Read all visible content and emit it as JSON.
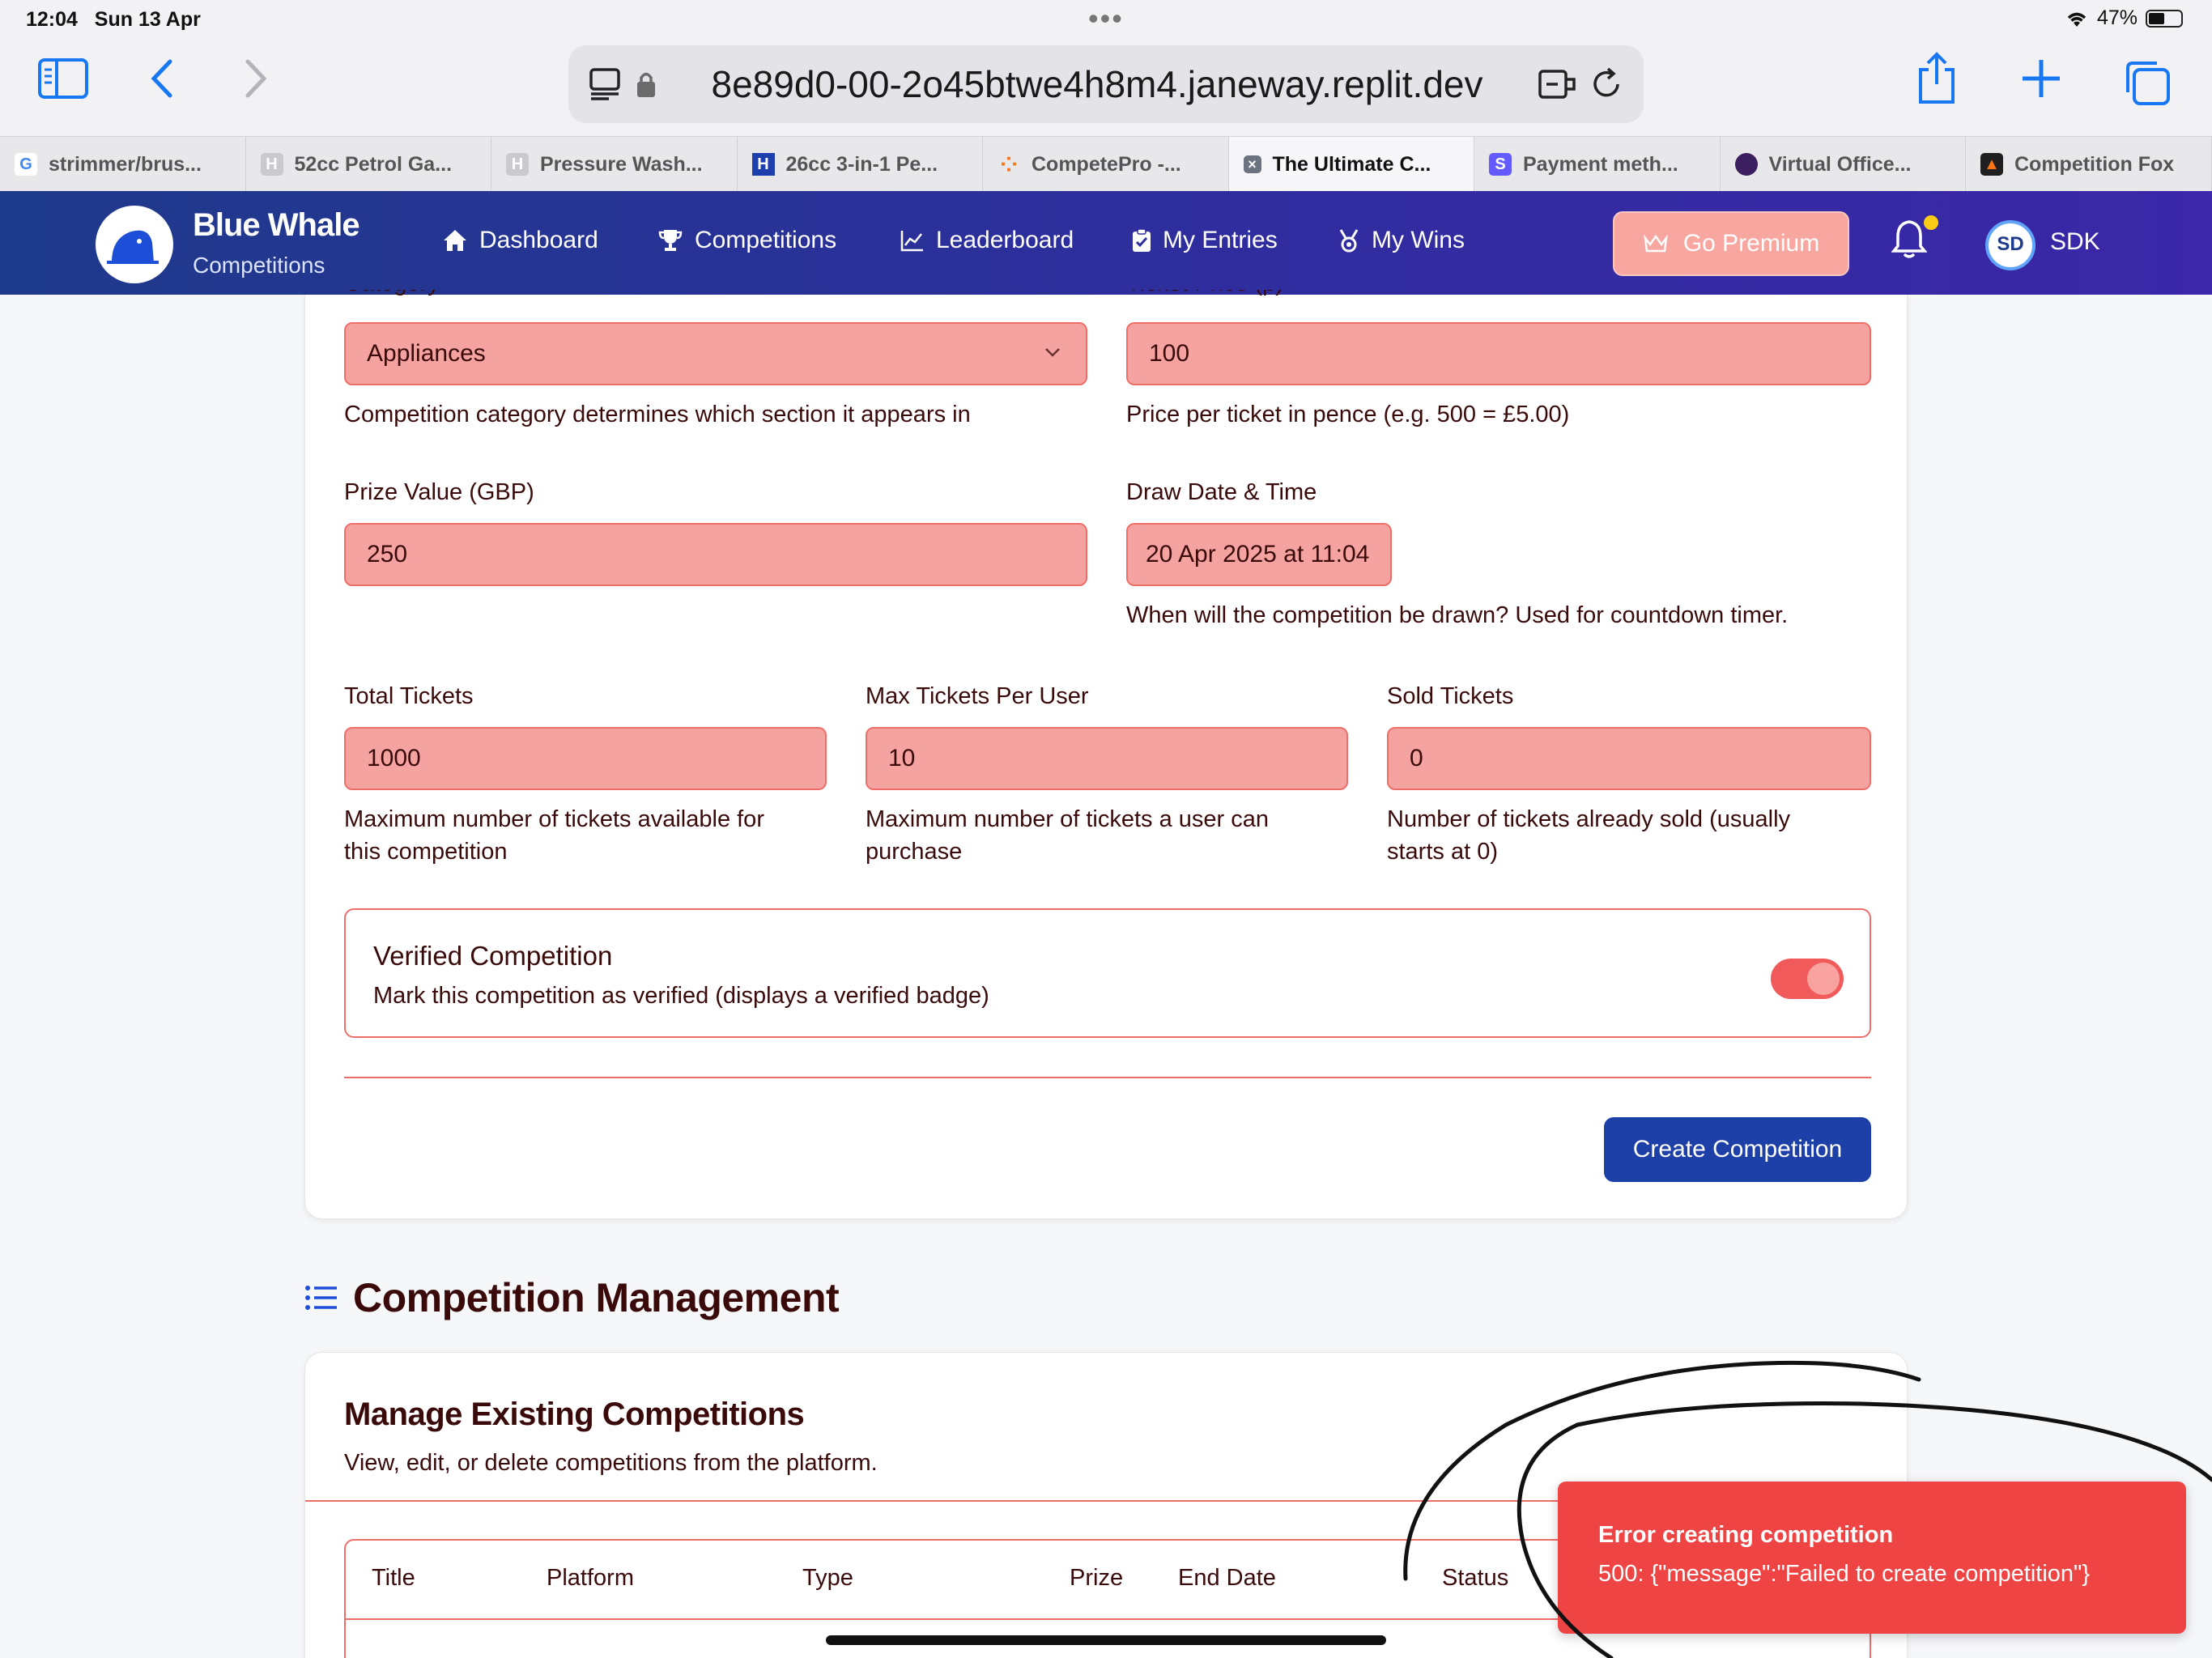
{
  "status": {
    "time": "12:04",
    "date": "Sun 13 Apr",
    "battery": "47%"
  },
  "browser": {
    "url": "8e89d0-00-2o45btwe4h8m4.janeway.replit.dev",
    "tabs": [
      {
        "label": "strimmer/brus...",
        "fav": "G",
        "fav_color": "#ffffff"
      },
      {
        "label": "52cc Petrol Ga...",
        "fav": "H",
        "fav_color": "#c9c9cf"
      },
      {
        "label": "Pressure Wash...",
        "fav": "H",
        "fav_color": "#c9c9cf"
      },
      {
        "label": "26cc 3-in-1 Pe...",
        "fav": "H",
        "fav_color": "#1e40af"
      },
      {
        "label": "CompetePro -...",
        "fav": "",
        "fav_color": "#f97316"
      },
      {
        "label": "The Ultimate C...",
        "fav": "×",
        "fav_color": "#6b7280"
      },
      {
        "label": "Payment meth...",
        "fav": "S",
        "fav_color": "#635bff"
      },
      {
        "label": "Virtual Office...",
        "fav": "",
        "fav_color": "#3b1f5e"
      },
      {
        "label": "Competition Fox",
        "fav": "",
        "fav_color": "#1f1f1f"
      }
    ]
  },
  "app": {
    "brand_title": "Blue Whale",
    "brand_sub": "Competitions",
    "nav": [
      "Dashboard",
      "Competitions",
      "Leaderboard",
      "My Entries",
      "My Wins"
    ],
    "premium": "Go Premium",
    "avatar": "SD",
    "username": "SDK"
  },
  "form": {
    "category_label": "Category",
    "category_value": "Appliances",
    "category_help": "Competition category determines which section it appears in",
    "price_label": "Ticket Price (p)",
    "price_value": "100",
    "price_help": "Price per ticket in pence (e.g. 500 = £5.00)",
    "prize_label": "Prize Value (GBP)",
    "prize_value": "250",
    "draw_label": "Draw Date & Time",
    "draw_value": "20 Apr 2025 at 11:04",
    "draw_help": "When will the competition be drawn? Used for countdown timer.",
    "total_label": "Total Tickets",
    "total_value": "1000",
    "total_help_1": "Maximum number of tickets available for",
    "total_help_2": "this competition",
    "max_label": "Max Tickets Per User",
    "max_value": "10",
    "max_help_1": "Maximum number of tickets a user can",
    "max_help_2": "purchase",
    "sold_label": "Sold Tickets",
    "sold_value": "0",
    "sold_help_1": "Number of tickets already sold (usually",
    "sold_help_2": "starts at 0)",
    "verified_title": "Verified Competition",
    "verified_desc": "Mark this competition as verified (displays a verified badge)",
    "verified_on": true,
    "create_button": "Create Competition"
  },
  "management": {
    "section_title": "Competition Management",
    "card_title": "Manage Existing Competitions",
    "card_desc": "View, edit, or delete competitions from the platform.",
    "columns": [
      "Title",
      "Platform",
      "Type",
      "Prize",
      "End Date",
      "Status"
    ]
  },
  "toast": {
    "title": "Error creating competition",
    "message": "500: {\"message\":\"Failed to create competition\"}"
  }
}
